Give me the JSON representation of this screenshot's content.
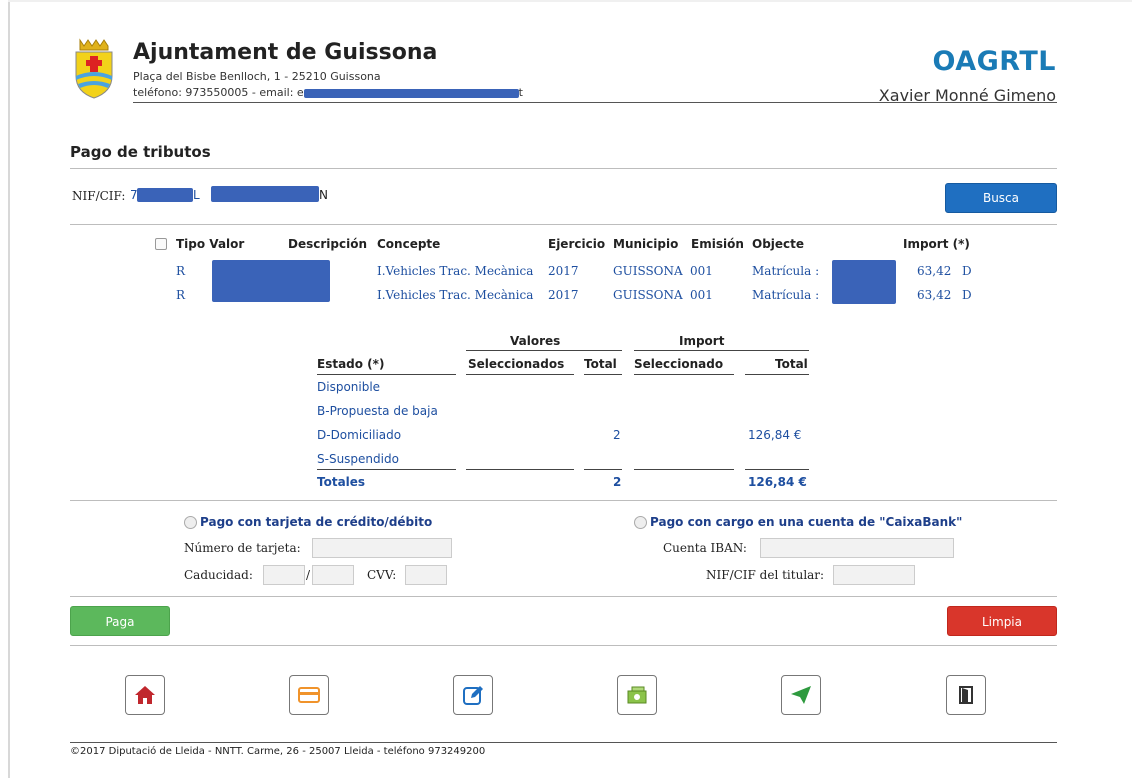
{
  "header": {
    "org_name": "Ajuntament de Guissona",
    "address": "Plaça del Bisbe Benlloch, 1 - 25210 Guissona",
    "contact_prefix": "teléfono: 973550005 - email: e",
    "contact_suffix": "t",
    "app_name": "OAGRTL",
    "user_name": "Xavier Monné Gimeno"
  },
  "page": {
    "title": "Pago de tributos",
    "nif_label": "NIF/CIF:",
    "nif_value_a": "7",
    "nif_value_b": "L",
    "nif_value_c": "N",
    "search_button": "Busca"
  },
  "results": {
    "columns": [
      "Tipo Valor",
      "Descripción",
      "Concepte",
      "Ejercicio",
      "Municipio",
      "Emisión",
      "Objecte",
      "Import (*)"
    ],
    "rows": [
      {
        "tipo": "R",
        "concepte": "I.Vehicles Trac. Mecànica",
        "ejercicio": "2017",
        "municipio": "GUISSONA",
        "emision": "001",
        "objecte": "Matrícula :",
        "import": "63,42",
        "estado": "D"
      },
      {
        "tipo": "R",
        "concepte": "I.Vehicles Trac. Mecànica",
        "ejercicio": "2017",
        "municipio": "GUISSONA",
        "emision": "001",
        "objecte": "Matrícula :",
        "import": "63,42",
        "estado": "D"
      }
    ]
  },
  "summary": {
    "group_valores": "Valores",
    "group_import": "Import",
    "col_estado": "Estado (*)",
    "col_seleccionados": "Seleccionados",
    "col_total": "Total",
    "col_seleccionado": "Seleccionado",
    "col_total2": "Total",
    "rows": [
      {
        "estado": "Disponible",
        "total": "",
        "import_total": ""
      },
      {
        "estado": "B-Propuesta de baja",
        "total": "",
        "import_total": ""
      },
      {
        "estado": "D-Domiciliado",
        "total": "2",
        "import_total": "126,84 €"
      },
      {
        "estado": "S-Suspendido",
        "total": "",
        "import_total": ""
      }
    ],
    "totales_label": "Totales",
    "totales_count": "2",
    "totales_import": "126,84 €"
  },
  "payment": {
    "card_option": "Pago con tarjeta de crédito/débito",
    "card_number_label": "Número de tarjeta:",
    "expiry_label": "Caducidad:",
    "expiry_sep": "/",
    "cvv_label": "CVV:",
    "bank_option": "Pago con cargo en una cuenta de \"CaixaBank\"",
    "iban_label": "Cuenta IBAN:",
    "holder_label": "NIF/CIF del titular:",
    "pay_button": "Paga",
    "clear_button": "Limpia"
  },
  "icons": [
    "home-icon",
    "card-icon",
    "edit-icon",
    "money-icon",
    "send-icon",
    "exit-icon"
  ],
  "colors": {
    "accent": "#1a7bb6",
    "link": "#1e4fa0",
    "pay": "#5cb85c",
    "clear": "#d9362b",
    "search": "#1f6fc1"
  },
  "footer": {
    "text": "©2017 Diputació de Lleida - NNTT. Carme, 26 - 25007 Lleida - teléfono 973249200"
  }
}
